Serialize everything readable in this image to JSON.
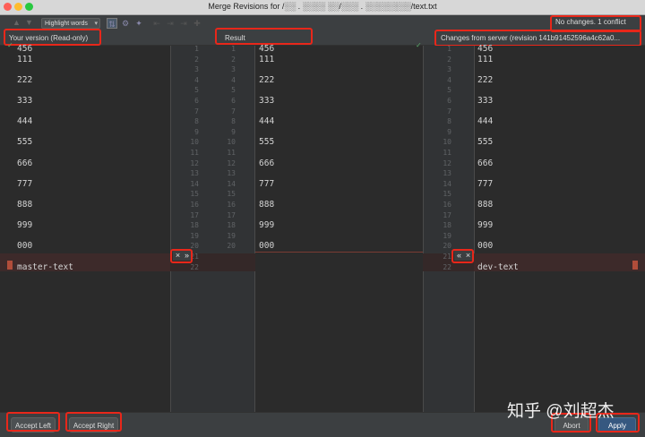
{
  "window": {
    "title": "Merge Revisions for /░░ . ░░░░ ░░/░░░ . ░░░░░░░░/text.txt"
  },
  "toolbar": {
    "highlight_label": "Highlight words",
    "status": "No changes. 1 conflict"
  },
  "headers": {
    "left": "Your version (Read-only)",
    "center": "Result",
    "right": "Changes from server (revision 141b91452596a4c62a0..."
  },
  "common_lines": [
    {
      "num": 1,
      "text": "456"
    },
    {
      "num": 2,
      "text": "111"
    },
    {
      "num": 3,
      "text": ""
    },
    {
      "num": 4,
      "text": "222"
    },
    {
      "num": 5,
      "text": ""
    },
    {
      "num": 6,
      "text": "333"
    },
    {
      "num": 7,
      "text": ""
    },
    {
      "num": 8,
      "text": "444"
    },
    {
      "num": 9,
      "text": ""
    },
    {
      "num": 10,
      "text": "555"
    },
    {
      "num": 11,
      "text": ""
    },
    {
      "num": 12,
      "text": "666"
    },
    {
      "num": 13,
      "text": ""
    },
    {
      "num": 14,
      "text": "777"
    },
    {
      "num": 15,
      "text": ""
    },
    {
      "num": 16,
      "text": "888"
    },
    {
      "num": 17,
      "text": ""
    },
    {
      "num": 18,
      "text": "999"
    },
    {
      "num": 19,
      "text": ""
    },
    {
      "num": 20,
      "text": "000"
    }
  ],
  "left_extra": [
    {
      "num": 21,
      "text": ""
    },
    {
      "num": 22,
      "text": "master-text"
    }
  ],
  "right_extra": [
    {
      "num": 21,
      "text": ""
    },
    {
      "num": 22,
      "text": "dev-text"
    }
  ],
  "chips": {
    "left_ignore": "×",
    "left_apply": "»",
    "right_apply": "«",
    "right_ignore": "×"
  },
  "buttons": {
    "accept_left": "Accept Left",
    "accept_right": "Accept Right",
    "abort": "Abort",
    "apply": "Apply"
  },
  "watermark": "知乎 @刘超杰",
  "colors": {
    "accent_red": "#e8271a",
    "apply_blue": "#365880",
    "conflict": "#b04d3a",
    "ok_green": "#59a869"
  }
}
